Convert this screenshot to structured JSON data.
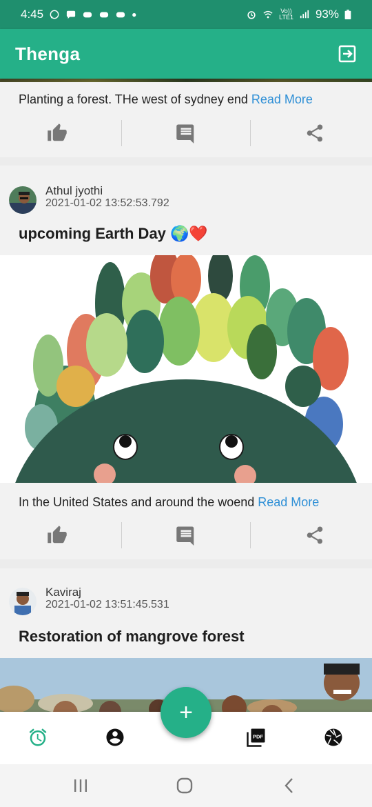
{
  "status_bar": {
    "time": "4:45",
    "battery": "93%",
    "volte_label": "Vo))",
    "lte_label": "LTE1"
  },
  "app_bar": {
    "title": "Thenga"
  },
  "posts": [
    {
      "body_text": "Planting a forest. THe west of sydney end",
      "read_more": "Read More"
    },
    {
      "author": "Athul jyothi",
      "timestamp": "2021-01-02 13:52:53.792",
      "title": "upcoming Earth Day 🌍❤️",
      "body_text": "In the United States and around the woend",
      "read_more": "Read More"
    },
    {
      "author": "Kaviraj",
      "timestamp": "2021-01-02 13:51:45.531",
      "title": "Restoration of mangrove forest"
    }
  ],
  "bottom_nav": {
    "fab_label": "+",
    "items": [
      "alarm-icon",
      "account-icon",
      "pdf-icon",
      "camera-aperture-icon"
    ],
    "pdf_badge": "PDF"
  },
  "colors": {
    "primary": "#25b088",
    "status_bar": "#1f8f6e",
    "link": "#2e8fd6"
  }
}
